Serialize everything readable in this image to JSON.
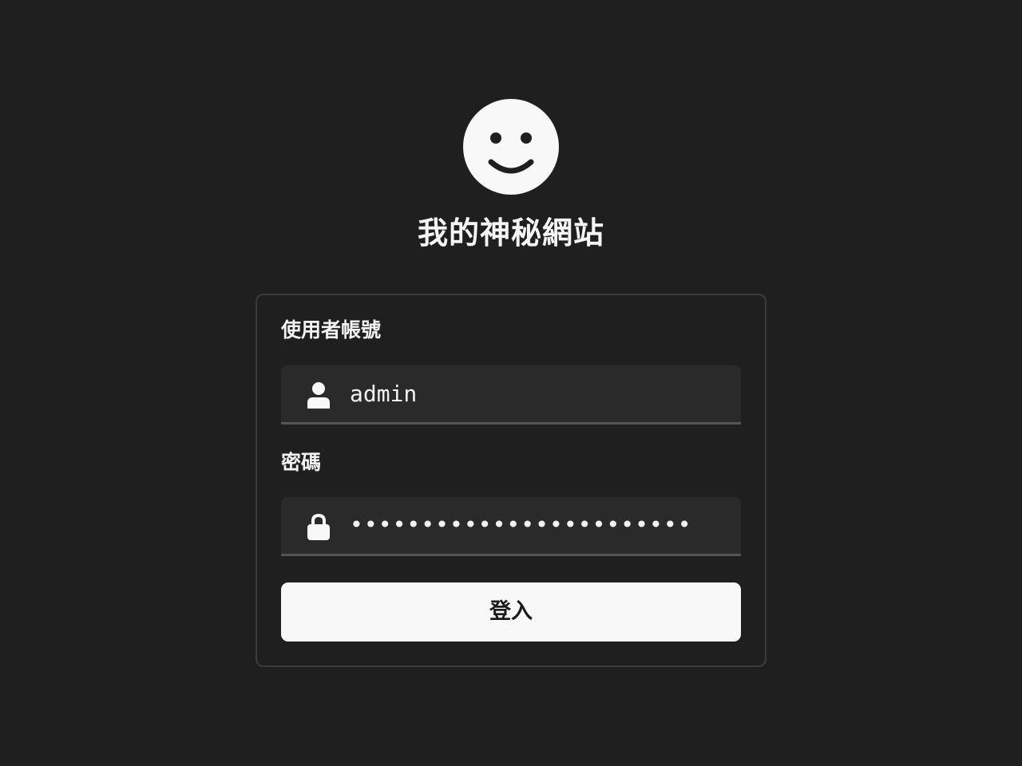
{
  "header": {
    "logo_icon": "smiley-face-icon",
    "title": "我的神秘網站"
  },
  "form": {
    "username": {
      "label": "使用者帳號",
      "icon": "user-icon",
      "value": "admin"
    },
    "password": {
      "label": "密碼",
      "icon": "lock-icon",
      "masked_value": "••••••••••••••••••••••••"
    },
    "submit_label": "登入"
  },
  "colors": {
    "background": "#1f1f1f",
    "card_border": "#3b3b3b",
    "input_background": "#2a2a2a",
    "button_background": "#f8f8f8",
    "text": "#f2f2f2"
  }
}
